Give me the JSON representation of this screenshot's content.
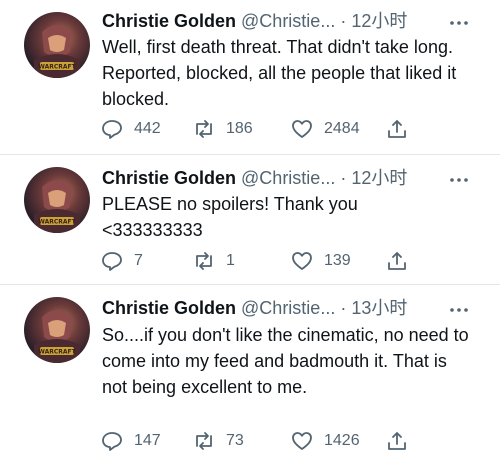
{
  "tweets": [
    {
      "name": "Christie Golden",
      "handle": "@Christie...",
      "sep": "·",
      "time": "12小时",
      "text": "Well, first death threat. That didn't take long.  Reported, blocked, all the people that liked it blocked.",
      "replies": "442",
      "retweets": "186",
      "likes": "2484"
    },
    {
      "name": "Christie Golden",
      "handle": "@Christie...",
      "sep": "·",
      "time": "12小时",
      "text": "PLEASE no spoilers! Thank you <333333333",
      "replies": "7",
      "retweets": "1",
      "likes": "139"
    },
    {
      "name": "Christie Golden",
      "handle": "@Christie...",
      "sep": "·",
      "time": "13小时",
      "text": "So....if you don't like the cinematic, no need to come into my feed and badmouth it.  That is not being excellent to me.",
      "replies": "147",
      "retweets": "73",
      "likes": "1426"
    }
  ],
  "avatar_caption": "WARCRAFT",
  "icons": [
    "reply-icon",
    "retweet-icon",
    "like-icon",
    "share-icon",
    "more-icon"
  ],
  "colors": {
    "text": "#0f1419",
    "secondary": "#536471",
    "divider": "#e1e8ed"
  }
}
